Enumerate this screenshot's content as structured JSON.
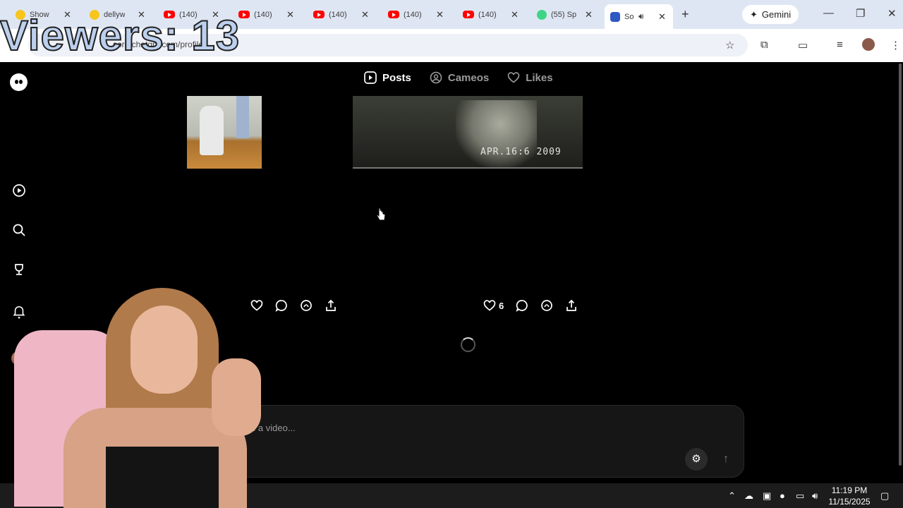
{
  "overlay": {
    "viewers": "Viewers: 13"
  },
  "browser": {
    "tabs": [
      {
        "title": "Show",
        "icon": "yellow"
      },
      {
        "title": "dellyw",
        "icon": "yellow"
      },
      {
        "title": "(140)",
        "icon": "youtube"
      },
      {
        "title": "(140)",
        "icon": "youtube"
      },
      {
        "title": "(140)",
        "icon": "youtube"
      },
      {
        "title": "(140)",
        "icon": "youtube"
      },
      {
        "title": "(140)",
        "icon": "youtube"
      },
      {
        "title": "(55) Sp",
        "icon": "green"
      },
      {
        "title": "So",
        "icon": "blue",
        "active": true
      }
    ],
    "gemini_label": "Gemini",
    "url": "sora.chatgpt.com/profile"
  },
  "page": {
    "tabs": {
      "posts": "Posts",
      "cameos": "Cameos",
      "likes": "Likes"
    },
    "thumb_stamp": "APR.16:6 2009",
    "post_right": {
      "likes": "6"
    },
    "composer_placeholder": "Describe a video..."
  },
  "taskbar": {
    "time": "11:19 PM",
    "date": "11/15/2025"
  },
  "colors": {
    "accent": "#ffffff",
    "background": "#000000",
    "tabstrip": "#dfe6f3"
  }
}
